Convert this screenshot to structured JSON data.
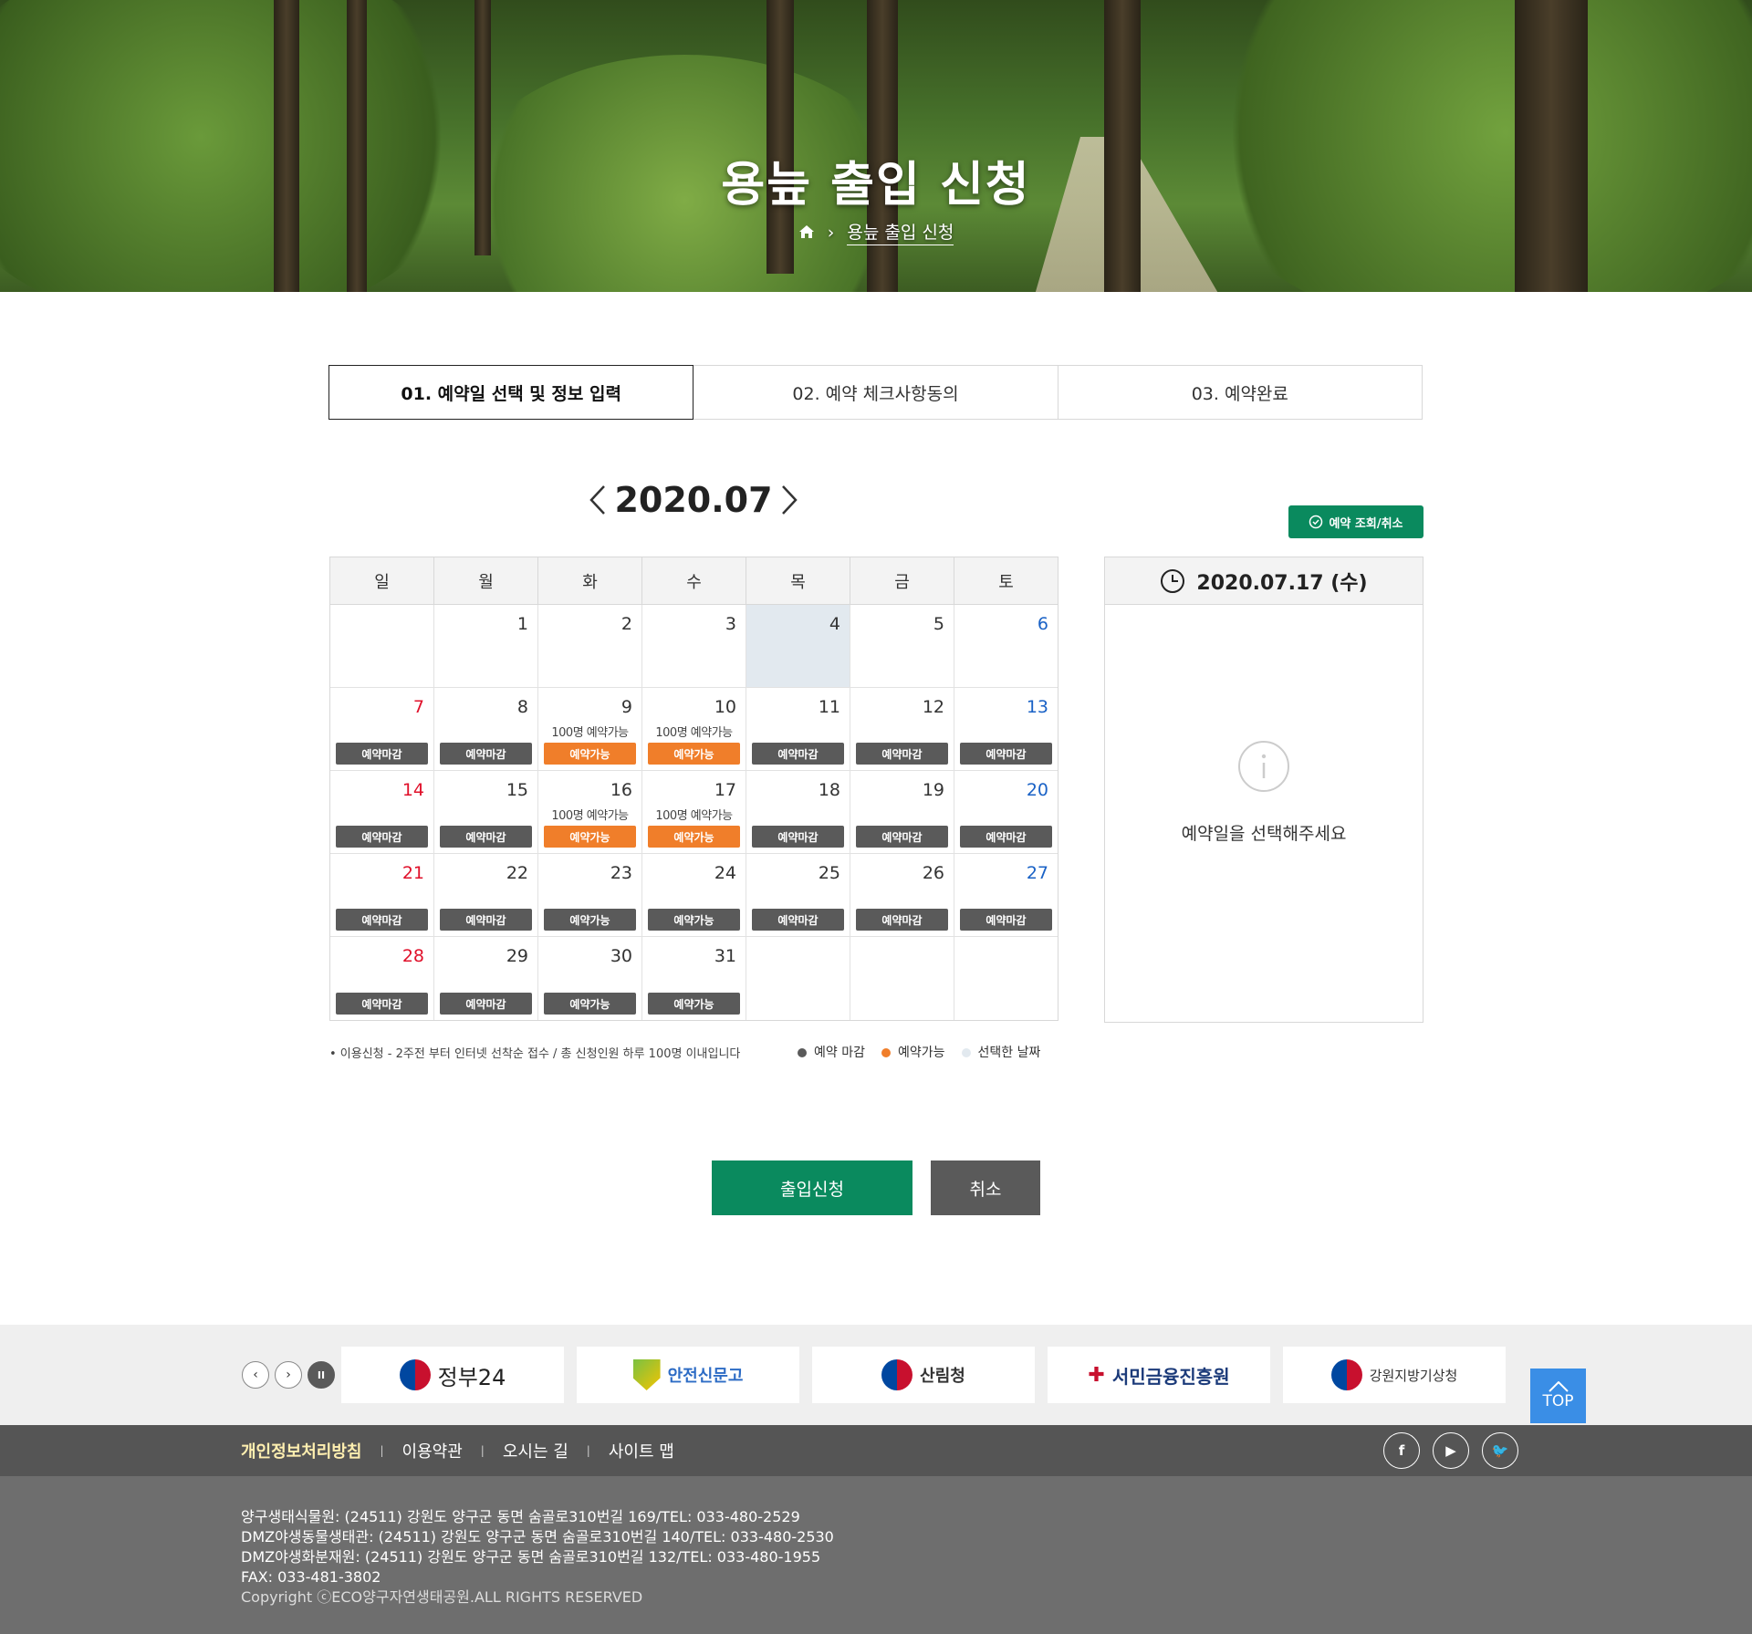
{
  "hero": {
    "title": "용늪 출입 신청",
    "breadcrumb_current": "용늪 출입 신청"
  },
  "steps": [
    {
      "label": "01. 예약일 선택 및 정보 입력",
      "active": true
    },
    {
      "label": "02. 예약 체크사항동의",
      "active": false
    },
    {
      "label": "03. 예약완료",
      "active": false
    }
  ],
  "calendar": {
    "month": "2020.07",
    "lookup_label": "예약 조회/취소",
    "weekdays": [
      "일",
      "월",
      "화",
      "수",
      "목",
      "금",
      "토"
    ],
    "weeks": [
      [
        {
          "day": "",
          "avail": "",
          "badge": ""
        },
        {
          "day": "1",
          "avail": "",
          "badge": ""
        },
        {
          "day": "2",
          "avail": "",
          "badge": ""
        },
        {
          "day": "3",
          "avail": "",
          "badge": ""
        },
        {
          "day": "4",
          "avail": "",
          "badge": "",
          "today": true
        },
        {
          "day": "5",
          "avail": "",
          "badge": ""
        },
        {
          "day": "6",
          "avail": "",
          "badge": ""
        }
      ],
      [
        {
          "day": "7",
          "avail": "",
          "badge": "예약마감"
        },
        {
          "day": "8",
          "avail": "",
          "badge": "예약마감"
        },
        {
          "day": "9",
          "avail": "100명 예약가능",
          "badge": "예약가능",
          "open": true
        },
        {
          "day": "10",
          "avail": "100명 예약가능",
          "badge": "예약가능",
          "open": true
        },
        {
          "day": "11",
          "avail": "",
          "badge": "예약마감"
        },
        {
          "day": "12",
          "avail": "",
          "badge": "예약마감"
        },
        {
          "day": "13",
          "avail": "",
          "badge": "예약마감"
        }
      ],
      [
        {
          "day": "14",
          "avail": "",
          "badge": "예약마감"
        },
        {
          "day": "15",
          "avail": "",
          "badge": "예약마감"
        },
        {
          "day": "16",
          "avail": "100명 예약가능",
          "badge": "예약가능",
          "open": true
        },
        {
          "day": "17",
          "avail": "100명 예약가능",
          "badge": "예약가능",
          "open": true
        },
        {
          "day": "18",
          "avail": "",
          "badge": "예약마감"
        },
        {
          "day": "19",
          "avail": "",
          "badge": "예약마감"
        },
        {
          "day": "20",
          "avail": "",
          "badge": "예약마감"
        }
      ],
      [
        {
          "day": "21",
          "avail": "",
          "badge": "예약마감"
        },
        {
          "day": "22",
          "avail": "",
          "badge": "예약마감"
        },
        {
          "day": "23",
          "avail": "",
          "badge": "예약가능"
        },
        {
          "day": "24",
          "avail": "",
          "badge": "예약가능"
        },
        {
          "day": "25",
          "avail": "",
          "badge": "예약마감"
        },
        {
          "day": "26",
          "avail": "",
          "badge": "예약마감"
        },
        {
          "day": "27",
          "avail": "",
          "badge": "예약마감"
        }
      ],
      [
        {
          "day": "28",
          "avail": "",
          "badge": "예약마감"
        },
        {
          "day": "29",
          "avail": "",
          "badge": "예약마감"
        },
        {
          "day": "30",
          "avail": "",
          "badge": "예약가능"
        },
        {
          "day": "31",
          "avail": "",
          "badge": "예약가능"
        },
        {
          "day": "",
          "avail": "",
          "badge": ""
        },
        {
          "day": "",
          "avail": "",
          "badge": ""
        },
        {
          "day": "",
          "avail": "",
          "badge": ""
        }
      ]
    ]
  },
  "panel": {
    "date": "2020.07.17 (수)",
    "message": "예약일을 선택해주세요"
  },
  "note": "• 이용신청 - 2주전 부터 인터넷 선착순 접수 / 총 신청인원 하루 100명 이내입니다",
  "legend": [
    {
      "label": "예약 마감",
      "color": "#5a5a5a"
    },
    {
      "label": "예약가능",
      "color": "#f07e2a"
    },
    {
      "label": "선택한 날짜",
      "color": "#e2e9ef"
    }
  ],
  "buttons": {
    "apply": "출입신청",
    "cancel": "취소"
  },
  "banners": [
    "정부24",
    "안전신문고",
    "산림청",
    "서민금융진흥원",
    "강원지방기상청"
  ],
  "top_label": "TOP",
  "footer": {
    "links": [
      "개인정보처리방침",
      "이용약관",
      "오시는 길",
      "사이트 맵"
    ],
    "lines": [
      "양구생태식물원: (24511) 강원도 양구군 동면 숨골로310번길 169/TEL: 033-480-2529",
      "DMZ야생동물생태관: (24511) 강원도 양구군 동면 숨골로310번길 140/TEL: 033-480-2530",
      "DMZ야생화분재원: (24511) 강원도 양구군 동면 숨골로310번길 132/TEL: 033-480-1955",
      "FAX: 033-481-3802"
    ],
    "copyright": "Copyright ⓒECO양구자연생태공원.ALL RIGHTS RESERVED"
  },
  "colors": {
    "accent": "#0a8a5e",
    "open": "#f07e2a",
    "closed": "#5a5a5a",
    "today": "#e2e9ef"
  }
}
